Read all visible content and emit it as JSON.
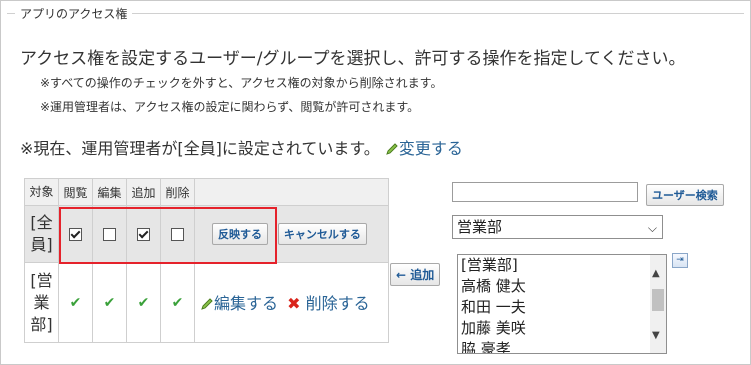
{
  "fieldset": {
    "legend": "アプリのアクセス権"
  },
  "intro": "アクセス権を設定するユーザー/グループを選択し、許可する操作を指定してください。",
  "notes": [
    "※すべての操作のチェックを外すと、アクセス権の対象から削除されます。",
    "※運用管理者は、アクセス権の設定に関わらず、閲覧が許可されます。"
  ],
  "current": {
    "text": "※現在、運用管理者が[全員]に設定されています。",
    "change_link": "変更する"
  },
  "table": {
    "headers": [
      "対象",
      "閲覧",
      "編集",
      "追加",
      "削除"
    ],
    "rows": [
      {
        "target_lines": [
          "[全",
          "員]"
        ],
        "view": true,
        "edit": false,
        "add": true,
        "delete": false,
        "apply_label": "反映する",
        "cancel_label": "キャンセルする"
      },
      {
        "target_lines": [
          "[営",
          "業",
          "部]"
        ],
        "edit_link": "編集する",
        "delete_link": "削除する"
      }
    ]
  },
  "search": {
    "value": "",
    "button": "ユーザー検索"
  },
  "add_button": "← 追加",
  "group_select": {
    "selected": "営業部"
  },
  "members": [
    "[営業部]",
    "高橋 健太",
    "和田 一夫",
    "加藤 美咲",
    "脇 豪孝"
  ],
  "colors": {
    "accent_link": "#2a6496",
    "highlight_border": "#e5222b",
    "check_green": "#3aa13a",
    "delete_red": "#d9241b"
  },
  "icons": {
    "change": "pencil-icon",
    "expand": "expand-right-icon"
  }
}
